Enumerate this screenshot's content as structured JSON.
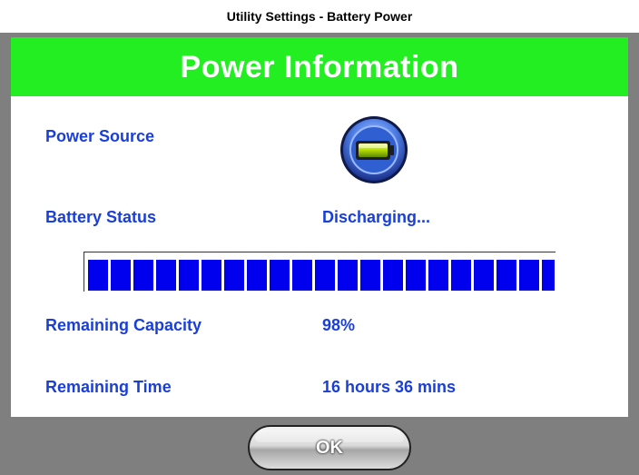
{
  "caption": "Utility Settings - Battery Power",
  "dialog": {
    "title": "Power Information",
    "colors": {
      "header": "#22ee22",
      "text": "#1a3fd9",
      "frame": "#7f7f7f",
      "progress": "#0000ee"
    },
    "rows": {
      "power_source": {
        "label": "Power Source",
        "icon": "battery-icon"
      },
      "battery_status": {
        "label": "Battery Status",
        "value": "Discharging..."
      },
      "remaining_capacity": {
        "label": "Remaining Capacity",
        "value": "98%"
      },
      "remaining_time": {
        "label": "Remaining Time",
        "value": "16 hours 36 mins"
      }
    },
    "progress": {
      "level": 0.98
    },
    "ok_label": "OK"
  }
}
